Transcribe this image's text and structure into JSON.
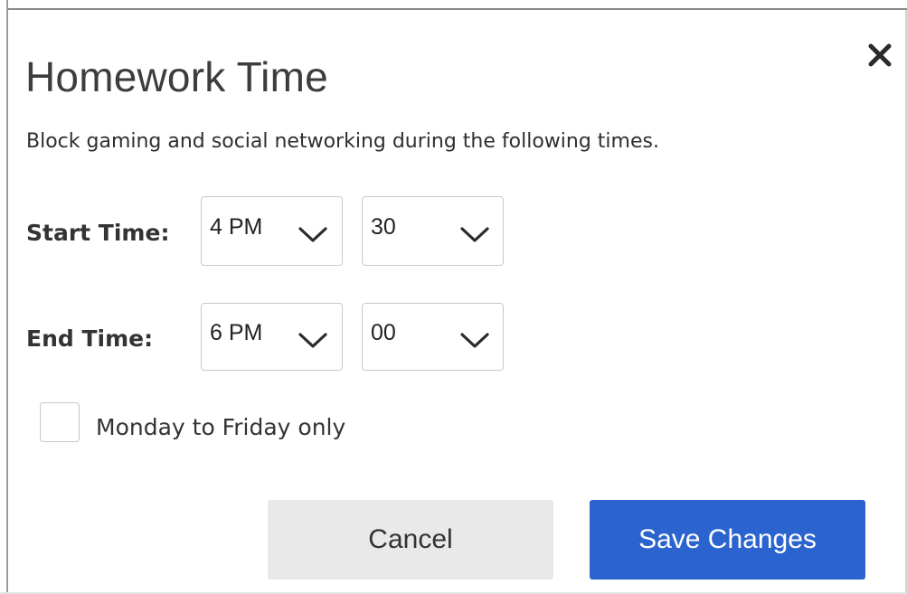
{
  "dialog": {
    "title": "Homework Time",
    "description": "Block gaming and social networking during the following times."
  },
  "start_time": {
    "label": "Start Time:",
    "hour": "4 PM",
    "minute": "30"
  },
  "end_time": {
    "label": "End Time:",
    "hour": "6 PM",
    "minute": "00"
  },
  "weekday_option": {
    "label": "Monday to Friday only",
    "checked": false
  },
  "buttons": {
    "cancel": "Cancel",
    "save": "Save Changes"
  },
  "colors": {
    "primary": "#2b64cf",
    "secondary_button": "#e9e9e9",
    "title_text": "#3d3d3d"
  },
  "icons": {
    "close": "close-icon",
    "dropdown": "chevron-down-icon"
  }
}
